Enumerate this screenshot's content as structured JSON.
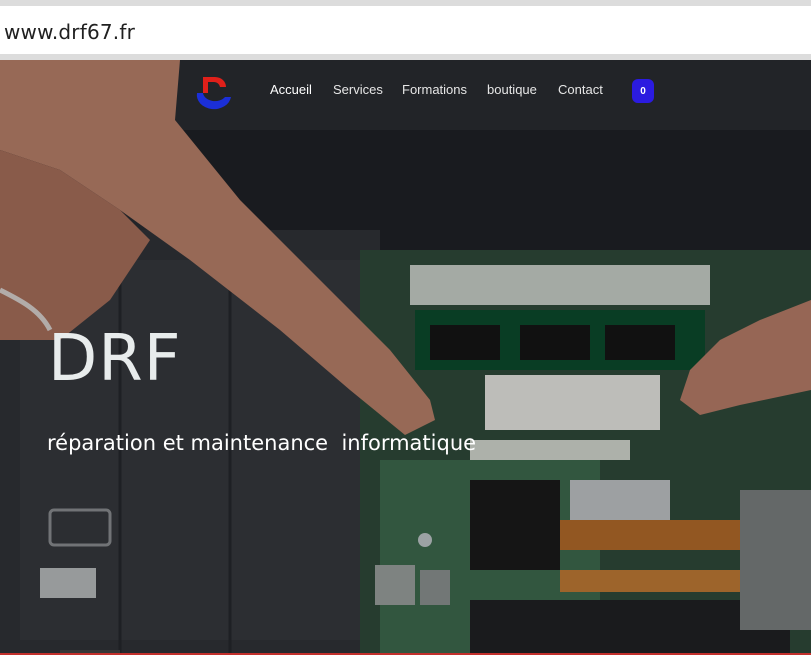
{
  "browser": {
    "url": "www.drf67.fr"
  },
  "nav": {
    "items": [
      {
        "label": "Accueil",
        "active": true
      },
      {
        "label": "Services"
      },
      {
        "label": "Formations"
      },
      {
        "label": "boutique"
      },
      {
        "label": "Contact"
      }
    ],
    "cart_count": "0"
  },
  "hero": {
    "title": "DRF",
    "subtitle": "réparation et maintenance  informatique"
  },
  "colors": {
    "cart_badge": "#2b1be0",
    "logo_red": "#e0201a",
    "logo_blue": "#1b2fd8"
  },
  "icons": {
    "logo": "drf-logo-icon",
    "cart": "cart-count-badge"
  }
}
